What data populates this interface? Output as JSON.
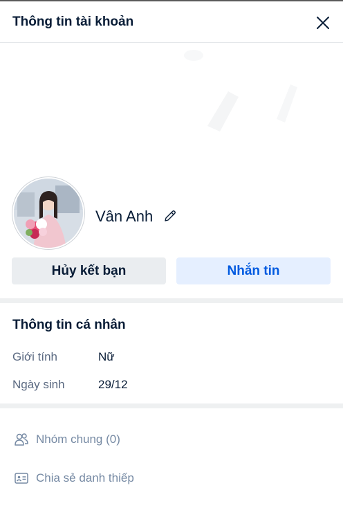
{
  "dialog": {
    "title": "Thông tin tài khoản",
    "close_icon": "close-icon"
  },
  "profile": {
    "name": "Vân Anh",
    "avatar_desc": "avatar-photo",
    "edit_icon": "pencil-icon"
  },
  "actions": {
    "unfriend_label": "Hủy kết bạn",
    "message_label": "Nhắn tin"
  },
  "personal_info": {
    "title": "Thông tin cá nhân",
    "gender_label": "Giới tính",
    "gender_value": "Nữ",
    "birthday_label": "Ngày sinh",
    "birthday_value": "29/12"
  },
  "more": {
    "common_groups_label": "Nhóm chung (0)",
    "share_card_label": "Chia sẻ danh thiếp"
  },
  "colors": {
    "primary": "#005ae0",
    "primary_light": "#e5efff",
    "secondary_button": "#eaedf0",
    "text": "#081c36",
    "muted": "#7589a3"
  }
}
